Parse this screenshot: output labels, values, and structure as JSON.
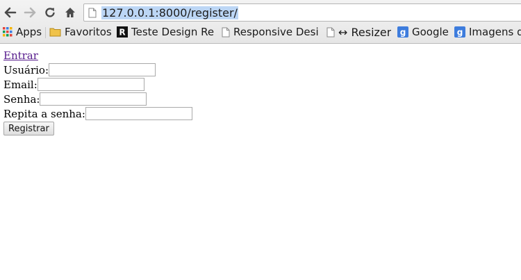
{
  "browser": {
    "url": "127.0.0.1:8000/register/",
    "bookmarks": [
      {
        "label": "Apps",
        "icon": "apps-grid-icon"
      },
      {
        "label": "Favoritos",
        "icon": "folder-icon"
      },
      {
        "label": "Teste Design Resp",
        "icon": "r-logo-icon"
      },
      {
        "label": "Responsive Desig",
        "icon": "page-icon"
      },
      {
        "label": "↔ Resizer",
        "icon": "page-icon"
      },
      {
        "label": "Google",
        "icon": "google-icon"
      },
      {
        "label": "Imagens do",
        "icon": "google-icon"
      }
    ]
  },
  "page": {
    "login_link": "Entrar",
    "form": {
      "username_label": "Usuário:",
      "email_label": "Email:",
      "password_label": "Senha:",
      "password_repeat_label": "Repita a senha:",
      "submit_label": "Registrar"
    }
  },
  "colors": {
    "link_visited": "#551a8b",
    "url_selection": "#bcd6f5",
    "bookmark_google_blue": "#3d7cdd",
    "folder_yellow": "#f0c34a"
  }
}
